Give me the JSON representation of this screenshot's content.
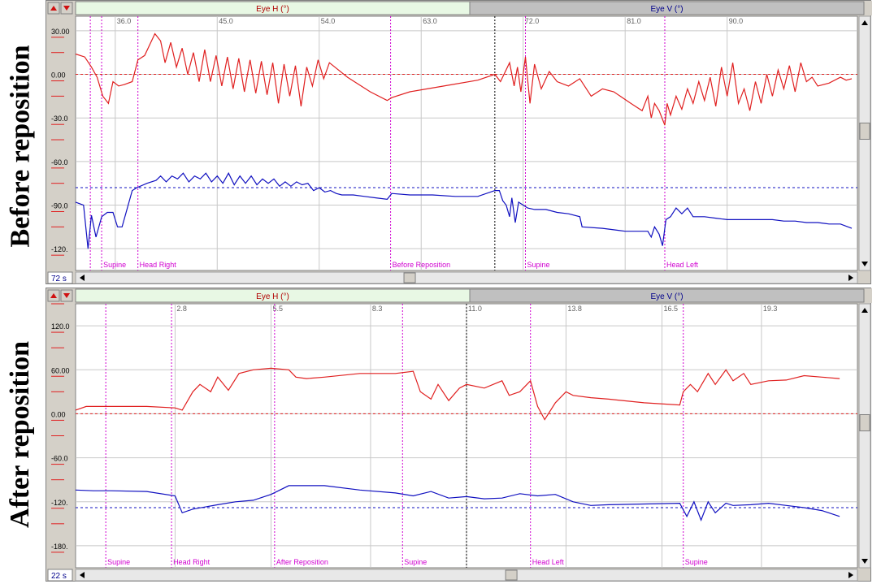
{
  "panels": [
    {
      "side_label": "Before reposition",
      "time_badge": "72 s",
      "tabs": [
        {
          "label": "Eye H (°)",
          "active": true
        },
        {
          "label": "Eye V (°)",
          "active": false
        }
      ],
      "colors": {
        "h": "#e02020",
        "v": "#1010c0",
        "event": "#d000d0",
        "cursor": "#000000",
        "grid": "#c8c8c8",
        "tab_active": "#e8f8e4",
        "tab_inactive": "#c0c0c0"
      },
      "chart_data": {
        "type": "line",
        "x_range": [
          32.5,
          101.5
        ],
        "x_ticks": [
          36.0,
          45.0,
          54.0,
          63.0,
          72.0,
          81.0,
          90.0
        ],
        "x_tick_labels": [
          "36.0",
          "45.0",
          "54.0",
          "63.0",
          "72.0",
          "81.0",
          "90.0"
        ],
        "y_range": [
          -135,
          40
        ],
        "y_ticks": [
          30,
          0,
          -30,
          -60,
          -90,
          -120
        ],
        "y_tick_labels": [
          "30.00",
          "0.00",
          "-30.0",
          "-60.0",
          "-90.0",
          "-120."
        ],
        "y_minor_ticks": [
          15,
          -15,
          -45,
          -75,
          -105
        ],
        "grid_y": [
          30,
          0,
          -30,
          -60,
          -90,
          -120
        ],
        "reference_lines": [
          {
            "series": "Eye H",
            "y": 0
          },
          {
            "series": "Eye V",
            "y": -78
          }
        ],
        "cursor_x": 69.5,
        "events": [
          {
            "x": 33.8,
            "label": ""
          },
          {
            "x": 34.8,
            "label": "Supine"
          },
          {
            "x": 38.0,
            "label": "Head Right"
          },
          {
            "x": 60.3,
            "label": "Before Reposition"
          },
          {
            "x": 72.2,
            "label": "Supine"
          },
          {
            "x": 84.5,
            "label": "Head Left"
          }
        ],
        "series": [
          {
            "name": "Eye H",
            "x": [
              32.5,
              33.3,
              33.9,
              34.4,
              34.9,
              35.4,
              35.8,
              36.3,
              36.8,
              37.5,
              38.0,
              38.6,
              39.5,
              40.0,
              40.4,
              40.9,
              41.4,
              41.9,
              42.4,
              42.9,
              43.4,
              43.9,
              44.4,
              44.9,
              45.4,
              45.9,
              46.4,
              46.9,
              47.4,
              47.9,
              48.4,
              48.9,
              49.4,
              49.9,
              50.4,
              50.9,
              51.4,
              51.9,
              52.4,
              52.9,
              53.4,
              53.9,
              54.4,
              54.9,
              56.5,
              58.5,
              60.0,
              60.4,
              62.0,
              65.0,
              68.0,
              69.5,
              70.0,
              70.8,
              71.2,
              71.5,
              71.8,
              72.2,
              72.6,
              73.0,
              73.6,
              74.3,
              75.0,
              76.0,
              77.0,
              78.0,
              79.0,
              80.0,
              81.5,
              82.5,
              83.0,
              83.3,
              83.6,
              84.0,
              84.5,
              84.7,
              85.0,
              85.5,
              86.0,
              86.5,
              87.0,
              87.5,
              88.0,
              88.5,
              89.0,
              89.5,
              90.0,
              90.5,
              91.0,
              91.5,
              92.0,
              92.5,
              93.0,
              93.5,
              94.0,
              94.5,
              95.0,
              95.5,
              96.0,
              96.5,
              97.0,
              97.5,
              98.0,
              99.0,
              100.0,
              100.5,
              101.0
            ],
            "y": [
              14,
              12,
              5,
              -2,
              -15,
              -20,
              -5,
              -8,
              -7,
              -5,
              10,
              13,
              28,
              23,
              8,
              22,
              5,
              18,
              0,
              15,
              -5,
              17,
              -5,
              13,
              -8,
              12,
              -10,
              11,
              -12,
              10,
              -13,
              9,
              -14,
              8,
              -20,
              7,
              -15,
              6,
              -22,
              5,
              -8,
              10,
              -3,
              8,
              -2,
              -12,
              -18,
              -16,
              -12,
              -8,
              -4,
              0,
              -5,
              8,
              -8,
              5,
              -12,
              12,
              -20,
              7,
              -10,
              2,
              -5,
              -8,
              -3,
              -15,
              -10,
              -12,
              -20,
              -25,
              -15,
              -30,
              -20,
              -25,
              -35,
              -20,
              -28,
              -15,
              -24,
              -10,
              -20,
              -5,
              -18,
              -2,
              -22,
              5,
              -15,
              8,
              -20,
              -10,
              -25,
              -5,
              -20,
              0,
              -15,
              3,
              -10,
              6,
              -12,
              8,
              -5,
              -2,
              -8,
              -6,
              -2,
              -4,
              -3
            ]
          },
          {
            "name": "Eye V",
            "x": [
              32.5,
              33.2,
              33.6,
              33.9,
              34.3,
              34.8,
              35.3,
              35.8,
              36.2,
              36.6,
              37.5,
              37.9,
              38.8,
              39.6,
              40.0,
              40.5,
              41.0,
              41.5,
              42.0,
              42.5,
              43.0,
              43.5,
              44.0,
              44.5,
              45.0,
              45.5,
              46.0,
              46.5,
              47.0,
              47.5,
              48.0,
              48.5,
              49.0,
              49.5,
              50.0,
              50.5,
              51.0,
              51.5,
              52.0,
              52.5,
              53.0,
              53.5,
              54.0,
              54.5,
              55.0,
              55.5,
              56.0,
              57.0,
              58.0,
              59.0,
              60.0,
              60.4,
              62.0,
              64.0,
              66.0,
              68.0,
              69.5,
              69.9,
              70.2,
              70.5,
              70.8,
              71.0,
              71.3,
              71.6,
              72.0,
              72.4,
              73.0,
              74.0,
              75.0,
              76.0,
              77.0,
              77.2,
              79.0,
              80.0,
              81.0,
              82.0,
              83.0,
              83.3,
              83.6,
              84.0,
              84.3,
              84.6,
              85.0,
              85.5,
              86.0,
              86.5,
              87.0,
              88.0,
              89.0,
              90.0,
              91.0,
              92.0,
              93.0,
              94.0,
              95.0,
              96.0,
              97.0,
              98.0,
              99.0,
              100.0,
              101.0
            ],
            "y": [
              -88,
              -90,
              -120,
              -97,
              -112,
              -98,
              -95,
              -95,
              -105,
              -105,
              -80,
              -78,
              -75,
              -73,
              -70,
              -74,
              -70,
              -72,
              -68,
              -74,
              -70,
              -72,
              -68,
              -74,
              -70,
              -75,
              -68,
              -76,
              -70,
              -75,
              -70,
              -76,
              -72,
              -75,
              -72,
              -77,
              -74,
              -77,
              -74,
              -76,
              -75,
              -80,
              -78,
              -81,
              -80,
              -82,
              -83,
              -83,
              -84,
              -85,
              -86,
              -82,
              -83,
              -83,
              -84,
              -84,
              -80,
              -80,
              -87,
              -90,
              -98,
              -85,
              -102,
              -88,
              -90,
              -92,
              -93,
              -93,
              -95,
              -96,
              -98,
              -105,
              -106,
              -107,
              -108,
              -108,
              -108,
              -112,
              -105,
              -110,
              -118,
              -100,
              -98,
              -92,
              -96,
              -92,
              -98,
              -98,
              -99,
              -100,
              -100,
              -100,
              -100,
              -100,
              -101,
              -101,
              -102,
              -102,
              -103,
              -103,
              -106
            ]
          }
        ]
      }
    },
    {
      "side_label": "After reposition",
      "time_badge": "22 s",
      "tabs": [
        {
          "label": "Eye H (°)",
          "active": true
        },
        {
          "label": "Eye V (°)",
          "active": false
        }
      ],
      "colors": {
        "h": "#e02020",
        "v": "#1010c0",
        "event": "#d000d0",
        "cursor": "#000000",
        "grid": "#c8c8c8",
        "tab_active": "#e8f8e4",
        "tab_inactive": "#c0c0c0"
      },
      "chart_data": {
        "type": "line",
        "x_range": [
          0,
          22
        ],
        "x_ticks": [
          2.8,
          5.5,
          8.3,
          11.0,
          13.8,
          16.5,
          19.3
        ],
        "x_tick_labels": [
          "2.8",
          "5.5",
          "8.3",
          "11.0",
          "13.8",
          "16.5",
          "19.3"
        ],
        "y_range": [
          -210,
          150
        ],
        "y_ticks": [
          120,
          60,
          0,
          -60,
          -120,
          -180
        ],
        "y_tick_labels": [
          "120.0",
          "60.00",
          "0.00",
          "-60.0",
          "-120.",
          "-180."
        ],
        "y_minor_ticks": [
          150,
          90,
          30,
          -30,
          -90,
          -150
        ],
        "grid_y": [
          120,
          60,
          0,
          -60,
          -120,
          -180
        ],
        "reference_lines": [
          {
            "series": "Eye H",
            "y": 0
          },
          {
            "series": "Eye V",
            "y": -128
          }
        ],
        "cursor_x": 11.0,
        "events": [
          {
            "x": 0.85,
            "label": "Supine"
          },
          {
            "x": 2.7,
            "label": "Head Right"
          },
          {
            "x": 5.6,
            "label": "After Reposition"
          },
          {
            "x": 9.2,
            "label": "Supine"
          },
          {
            "x": 12.8,
            "label": "Head Left"
          },
          {
            "x": 17.1,
            "label": "Supine"
          }
        ]
      }
    }
  ],
  "chart_data_series_after": [
    {
      "name": "Eye H",
      "x": [
        0.0,
        0.3,
        1.0,
        2.0,
        2.8,
        3.0,
        3.3,
        3.5,
        3.8,
        4.0,
        4.3,
        4.6,
        5.0,
        5.5,
        6.0,
        6.2,
        6.5,
        7.0,
        8.0,
        9.0,
        9.5,
        9.7,
        10.0,
        10.2,
        10.5,
        10.8,
        11.0,
        11.5,
        12.0,
        12.2,
        12.5,
        12.8,
        13.0,
        13.2,
        13.5,
        13.8,
        14.0,
        14.5,
        15.0,
        16.0,
        17.0,
        17.1,
        17.3,
        17.5,
        17.8,
        18.0,
        18.3,
        18.5,
        18.8,
        19.0,
        19.5,
        20.0,
        20.5,
        21.0,
        21.5
      ],
      "y": [
        5,
        10,
        10,
        10,
        8,
        5,
        30,
        40,
        30,
        50,
        32,
        55,
        60,
        62,
        60,
        50,
        48,
        50,
        55,
        55,
        58,
        30,
        20,
        40,
        18,
        35,
        40,
        35,
        45,
        25,
        30,
        45,
        10,
        -8,
        15,
        30,
        25,
        22,
        20,
        15,
        12,
        30,
        40,
        30,
        55,
        40,
        60,
        45,
        55,
        40,
        45,
        46,
        52,
        50,
        48
      ]
    },
    {
      "name": "Eye V",
      "x": [
        0.0,
        0.5,
        1.0,
        2.0,
        2.8,
        3.0,
        3.3,
        4.0,
        4.5,
        5.0,
        5.5,
        6.0,
        6.5,
        7.0,
        8.0,
        9.0,
        9.5,
        10.0,
        10.5,
        11.0,
        11.5,
        12.0,
        12.5,
        13.0,
        13.5,
        14.0,
        14.5,
        15.0,
        16.0,
        17.0,
        17.2,
        17.4,
        17.6,
        17.8,
        18.0,
        18.3,
        18.5,
        19.0,
        19.5,
        20.0,
        20.5,
        21.0,
        21.5
      ],
      "y": [
        -104,
        -105,
        -105,
        -106,
        -112,
        -135,
        -130,
        -124,
        -120,
        -118,
        -110,
        -98,
        -98,
        -98,
        -104,
        -108,
        -112,
        -106,
        -115,
        -113,
        -116,
        -115,
        -109,
        -112,
        -110,
        -120,
        -125,
        -124,
        -123,
        -122,
        -140,
        -120,
        -145,
        -120,
        -135,
        -122,
        -125,
        -124,
        -122,
        -125,
        -128,
        -132,
        -140
      ]
    }
  ]
}
